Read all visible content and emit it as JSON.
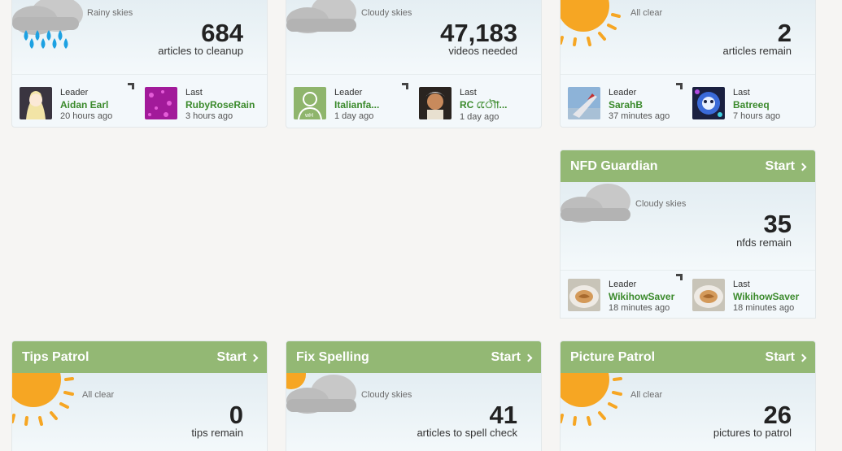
{
  "cards": {
    "c1": {
      "weather": "Rainy skies",
      "count": "684",
      "count_label": "articles to cleanup",
      "leader": {
        "role": "Leader",
        "name": "Aidan Earl",
        "time": "20 hours ago"
      },
      "last": {
        "role": "Last",
        "name": "RubyRoseRain",
        "time": "3 hours ago"
      }
    },
    "c2": {
      "weather": "Cloudy skies",
      "count": "47,183",
      "count_label": "videos needed",
      "leader": {
        "role": "Leader",
        "name": "Italianfa...",
        "time": "1 day ago"
      },
      "last": {
        "role": "Last",
        "name": "RC ৌো...",
        "time": "1 day ago"
      }
    },
    "c3": {
      "weather": "All clear",
      "count": "2",
      "count_label": "articles remain",
      "leader": {
        "role": "Leader",
        "name": "SarahB",
        "time": "37 minutes ago"
      },
      "last": {
        "role": "Last",
        "name": "Batreeq",
        "time": "7 hours ago"
      }
    },
    "nfd": {
      "title": "NFD Guardian",
      "start": "Start",
      "weather": "Cloudy skies",
      "count": "35",
      "count_label": "nfds remain",
      "leader": {
        "role": "Leader",
        "name": "WikihowSaver",
        "time": "18 minutes ago"
      },
      "last": {
        "role": "Last",
        "name": "WikihowSaver",
        "time": "18 minutes ago"
      }
    },
    "tips": {
      "title": "Tips Patrol",
      "start": "Start",
      "weather": "All clear",
      "count": "0",
      "count_label": "tips remain"
    },
    "spell": {
      "title": "Fix Spelling",
      "start": "Start",
      "weather": "Cloudy skies",
      "count": "41",
      "count_label": "articles to spell check"
    },
    "picture": {
      "title": "Picture Patrol",
      "start": "Start",
      "weather": "All clear",
      "count": "26",
      "count_label": "pictures to patrol"
    }
  },
  "icons": {
    "rain": "rain-cloud-icon",
    "cloud": "cloud-icon",
    "sun": "sun-icon",
    "corner": "corner-arrow-icon",
    "chevron": "chevron-right-icon"
  },
  "colors": {
    "header": "#93b874",
    "username": "#3b8a2c",
    "sun": "#f6a623"
  }
}
